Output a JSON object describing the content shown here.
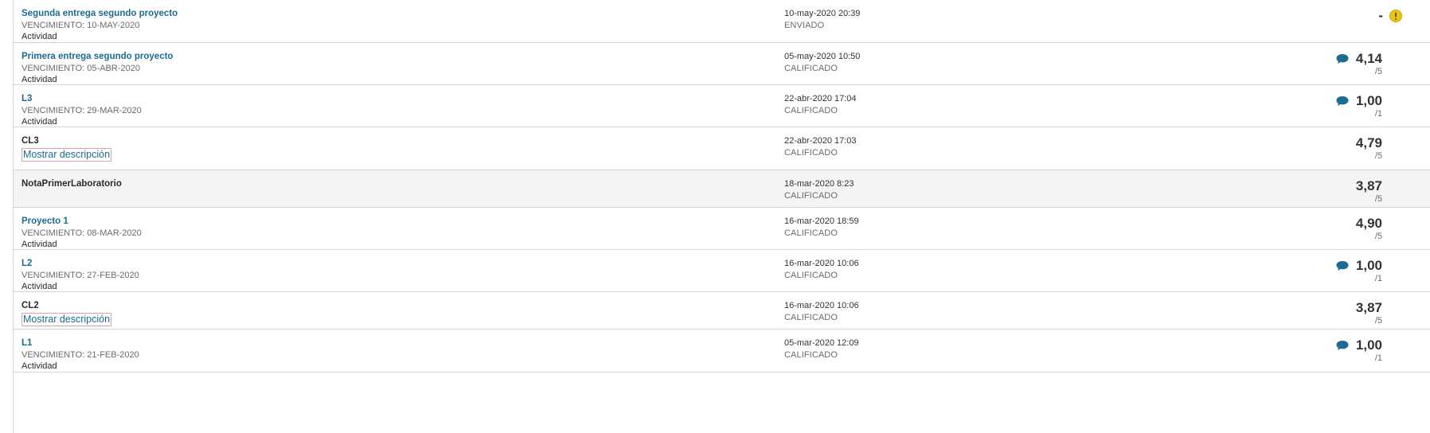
{
  "grades": [
    {
      "title": "Segunda entrega segundo proyecto",
      "title_link": true,
      "due": "VENCIMIENTO: 10-MAY-2020",
      "type": "Actividad",
      "date": "10-may-2020 20:39",
      "status": "ENVIADO",
      "score": "-",
      "possible": "",
      "comment": false,
      "warning": true
    },
    {
      "title": "Primera entrega segundo proyecto",
      "title_link": true,
      "due": "VENCIMIENTO: 05-ABR-2020",
      "type": "Actividad",
      "date": "05-may-2020 10:50",
      "status": "CALIFICADO",
      "score": "4,14",
      "possible": "/5",
      "comment": true
    },
    {
      "title": "L3",
      "title_link": true,
      "due": "VENCIMIENTO: 29-MAR-2020",
      "type": "Actividad",
      "date": "22-abr-2020 17:04",
      "status": "CALIFICADO",
      "score": "1,00",
      "possible": "/1",
      "comment": true
    },
    {
      "title": "CL3",
      "title_link": false,
      "description_button": "Mostrar descripción",
      "date": "22-abr-2020 17:03",
      "status": "CALIFICADO",
      "score": "4,79",
      "possible": "/5",
      "comment": false
    },
    {
      "title": "NotaPrimerLaboratorio",
      "title_link": false,
      "date": "18-mar-2020 8:23",
      "status": "CALIFICADO",
      "score": "3,87",
      "possible": "/5",
      "comment": false,
      "shaded": true
    },
    {
      "title": "Proyecto 1",
      "title_link": true,
      "due": "VENCIMIENTO: 08-MAR-2020",
      "type": "Actividad",
      "date": "16-mar-2020 18:59",
      "status": "CALIFICADO",
      "score": "4,90",
      "possible": "/5",
      "comment": false
    },
    {
      "title": "L2",
      "title_link": true,
      "due": "VENCIMIENTO: 27-FEB-2020",
      "type": "Actividad",
      "date": "16-mar-2020 10:06",
      "status": "CALIFICADO",
      "score": "1,00",
      "possible": "/1",
      "comment": true
    },
    {
      "title": "CL2",
      "title_link": false,
      "description_button": "Mostrar descripción",
      "date": "16-mar-2020 10:06",
      "status": "CALIFICADO",
      "score": "3,87",
      "possible": "/5",
      "comment": false
    },
    {
      "title": "L1",
      "title_link": true,
      "due": "VENCIMIENTO: 21-FEB-2020",
      "type": "Actividad",
      "date": "05-mar-2020 12:09",
      "status": "CALIFICADO",
      "score": "1,00",
      "possible": "/1",
      "comment": true
    }
  ],
  "colors": {
    "link": "#1c6b93",
    "comment_icon": "#1c6b93",
    "warning_icon": "#e8c51a"
  }
}
